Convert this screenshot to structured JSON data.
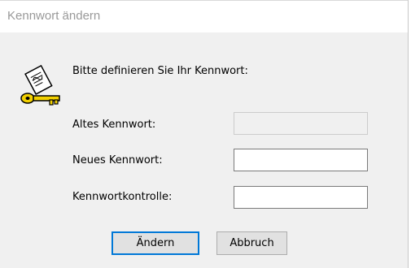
{
  "window": {
    "title": "Kennwort ändern"
  },
  "dialog": {
    "prompt": "Bitte definieren Sie Ihr Kennwort:",
    "icon": "key-document-icon",
    "fields": {
      "old_password": {
        "label": "Altes Kennwort:",
        "value": "",
        "enabled": false
      },
      "new_password": {
        "label": "Neues Kennwort:",
        "value": ""
      },
      "confirm_password": {
        "label": "Kennwortkontrolle:",
        "value": ""
      }
    },
    "buttons": {
      "change_label": "Ändern",
      "cancel_label": "Abbruch"
    }
  },
  "colors": {
    "accent": "#0078d7",
    "title_text": "#999999",
    "dialog_bg": "#f0f0f0"
  }
}
